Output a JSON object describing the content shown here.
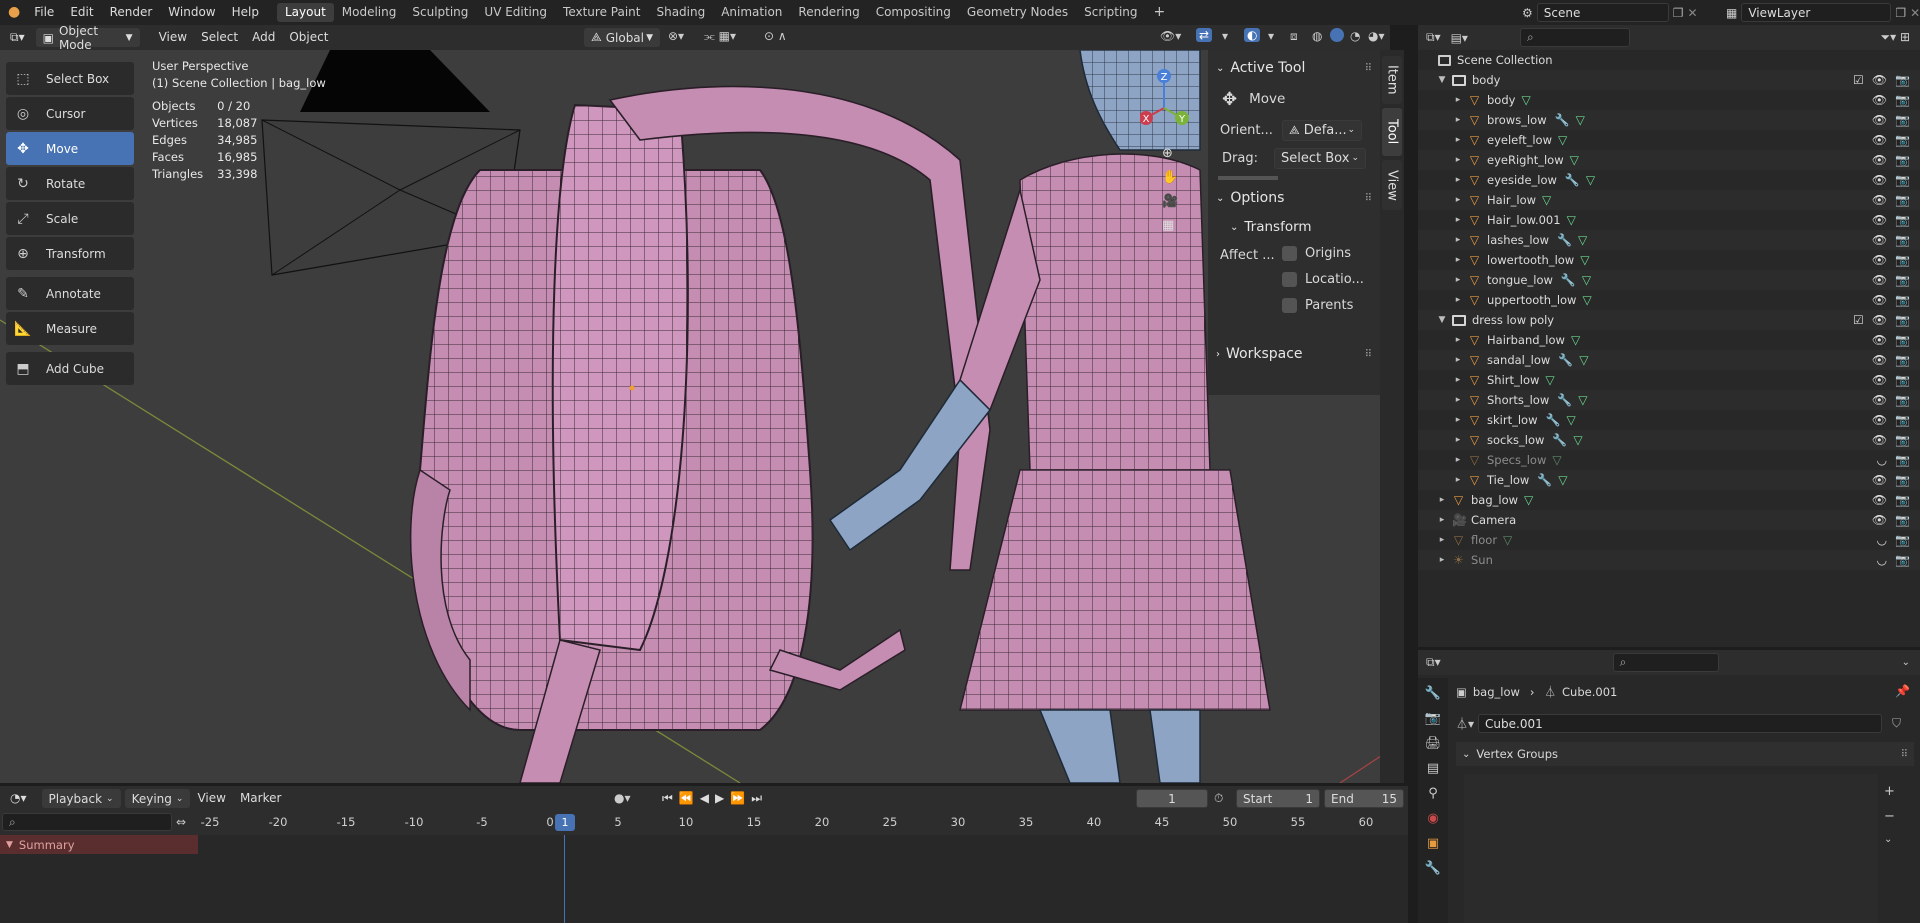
{
  "topbar": {
    "menus": [
      "File",
      "Edit",
      "Render",
      "Window",
      "Help"
    ],
    "workspaces": [
      "Layout",
      "Modeling",
      "Sculpting",
      "UV Editing",
      "Texture Paint",
      "Shading",
      "Animation",
      "Rendering",
      "Compositing",
      "Geometry Nodes",
      "Scripting"
    ],
    "active_workspace": "Layout",
    "add_tab": "+",
    "scene": "Scene",
    "view_layer": "ViewLayer"
  },
  "viewport_header": {
    "mode": "Object Mode",
    "menus": [
      "View",
      "Select",
      "Add",
      "Object"
    ],
    "orientation": "Global"
  },
  "viewport": {
    "view_name": "User Perspective",
    "context": "(1) Scene Collection | bag_low",
    "stats": [
      {
        "label": "Objects",
        "value": "0 / 20"
      },
      {
        "label": "Vertices",
        "value": "18,087"
      },
      {
        "label": "Edges",
        "value": "34,985"
      },
      {
        "label": "Faces",
        "value": "16,985"
      },
      {
        "label": "Triangles",
        "value": "33,398"
      }
    ],
    "gizmo_axes": {
      "x": "X",
      "y": "Y",
      "z": "Z"
    }
  },
  "toolbar": {
    "tools": [
      "Select Box",
      "Cursor",
      "Move",
      "Rotate",
      "Scale",
      "Transform",
      "Annotate",
      "Measure",
      "Add Cube"
    ],
    "active": "Move"
  },
  "npanel": {
    "tabs": [
      "Item",
      "Tool",
      "View"
    ],
    "active_tab": "Tool",
    "active_tool_title": "Active Tool",
    "active_tool_name": "Move",
    "orient_label": "Orient...",
    "orient_value": "Defa...",
    "drag_label": "Drag:",
    "drag_value": "Select Box",
    "options_title": "Options",
    "transform_title": "Transform",
    "affect_label": "Affect ...",
    "affect_options": [
      "Origins",
      "Locatio...",
      "Parents"
    ],
    "workspace_title": "Workspace"
  },
  "outliner": {
    "root": "Scene Collection",
    "rows": [
      {
        "name": "body",
        "type": "collection",
        "depth": 1,
        "dim": false
      },
      {
        "name": "body",
        "type": "mesh",
        "depth": 2,
        "dim": false
      },
      {
        "name": "brows_low",
        "type": "mesh",
        "depth": 2,
        "dim": false
      },
      {
        "name": "eyeleft_low",
        "type": "mesh",
        "depth": 2,
        "dim": false
      },
      {
        "name": "eyeRight_low",
        "type": "mesh",
        "depth": 2,
        "dim": false
      },
      {
        "name": "eyeside_low",
        "type": "mesh",
        "depth": 2,
        "dim": false
      },
      {
        "name": "Hair_low",
        "type": "mesh",
        "depth": 2,
        "dim": false
      },
      {
        "name": "Hair_low.001",
        "type": "mesh",
        "depth": 2,
        "dim": false
      },
      {
        "name": "lashes_low",
        "type": "mesh",
        "depth": 2,
        "dim": false
      },
      {
        "name": "lowertooth_low",
        "type": "mesh",
        "depth": 2,
        "dim": false
      },
      {
        "name": "tongue_low",
        "type": "mesh",
        "depth": 2,
        "dim": false
      },
      {
        "name": "uppertooth_low",
        "type": "mesh",
        "depth": 2,
        "dim": false
      },
      {
        "name": "dress low poly",
        "type": "collection",
        "depth": 1,
        "dim": false
      },
      {
        "name": "Hairband_low",
        "type": "mesh",
        "depth": 2,
        "dim": false
      },
      {
        "name": "sandal_low",
        "type": "mesh",
        "depth": 2,
        "dim": false
      },
      {
        "name": "Shirt_low",
        "type": "mesh",
        "depth": 2,
        "dim": false
      },
      {
        "name": "Shorts_low",
        "type": "mesh",
        "depth": 2,
        "dim": false
      },
      {
        "name": "skirt_low",
        "type": "mesh",
        "depth": 2,
        "dim": false
      },
      {
        "name": "socks_low",
        "type": "mesh",
        "depth": 2,
        "dim": false
      },
      {
        "name": "Specs_low",
        "type": "mesh",
        "depth": 2,
        "dim": true
      },
      {
        "name": "Tie_low",
        "type": "mesh",
        "depth": 2,
        "dim": false
      },
      {
        "name": "bag_low",
        "type": "mesh",
        "depth": 1,
        "dim": false
      },
      {
        "name": "Camera",
        "type": "camera",
        "depth": 1,
        "dim": false
      },
      {
        "name": "floor",
        "type": "mesh",
        "depth": 1,
        "dim": true
      },
      {
        "name": "Sun",
        "type": "light",
        "depth": 1,
        "dim": true
      }
    ]
  },
  "properties": {
    "object": "bag_low",
    "mesh": "Cube.001",
    "data_name": "Cube.001",
    "section": "Vertex Groups"
  },
  "timeline": {
    "menus": [
      "Playback",
      "Keying",
      "View",
      "Marker"
    ],
    "current_frame": "1",
    "start_label": "Start",
    "start": "1",
    "end_label": "End",
    "end": "15",
    "ruler": [
      "-25",
      "-20",
      "-15",
      "-10",
      "-5",
      "0",
      "5",
      "10",
      "15",
      "20",
      "25",
      "30",
      "35",
      "40",
      "45",
      "50",
      "55",
      "60"
    ],
    "playhead": "1",
    "summary": "Summary"
  },
  "colors": {
    "accent": "#4772b3",
    "mesh_pink": "#c58db2",
    "mesh_blue": "#8ea4c4",
    "vertex_group_bg": "#2b2b2b"
  }
}
